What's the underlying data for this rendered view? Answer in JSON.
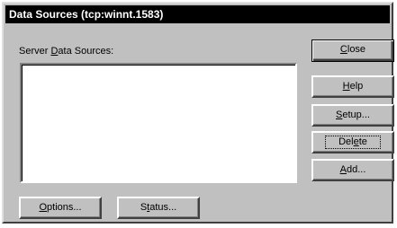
{
  "window": {
    "title": "Data Sources (tcp:winnt.1583)"
  },
  "list": {
    "label_pre": "Server ",
    "label_accel": "D",
    "label_post": "ata Sources:",
    "items": []
  },
  "buttons": {
    "close": {
      "pre": "",
      "accel": "C",
      "post": "lose"
    },
    "help": {
      "pre": "",
      "accel": "H",
      "post": "elp"
    },
    "setup": {
      "pre": "",
      "accel": "S",
      "post": "etup..."
    },
    "delete": {
      "pre": "Del",
      "accel": "e",
      "post": "te"
    },
    "add": {
      "pre": "",
      "accel": "A",
      "post": "dd..."
    },
    "options": {
      "pre": "",
      "accel": "O",
      "post": "ptions..."
    },
    "status": {
      "pre": "S",
      "accel": "t",
      "post": "atus..."
    }
  },
  "colors": {
    "face": "#c0c0c0",
    "titlebar": "#000000",
    "titletext": "#ffffff"
  }
}
